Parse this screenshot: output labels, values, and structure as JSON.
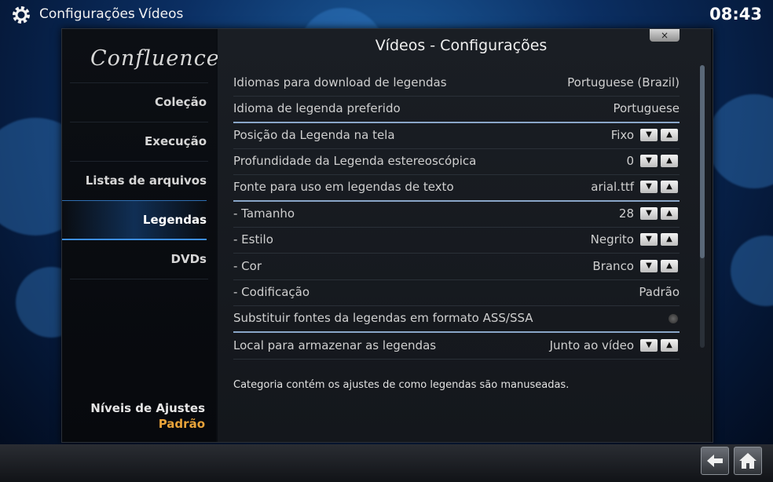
{
  "topbar": {
    "title": "Configurações",
    "subtitle": "- Vídeos",
    "clock": "08:43"
  },
  "sidebar": {
    "logo": "Confluence",
    "items": [
      {
        "label": "Coleção",
        "selected": false
      },
      {
        "label": "Execução",
        "selected": false
      },
      {
        "label": "Listas de arquivos",
        "selected": false
      },
      {
        "label": "Legendas",
        "selected": true
      },
      {
        "label": "DVDs",
        "selected": false
      }
    ],
    "levels_label": "Níveis de Ajustes",
    "levels_value": "Padrão"
  },
  "dialog": {
    "heading": "Vídeos - Configurações",
    "close_label": "×",
    "description": "Categoria contém os ajustes de como legendas são manuseadas."
  },
  "settings": [
    {
      "label": "Idiomas para download de legendas",
      "value": "Portuguese (Brazil)"
    },
    {
      "label": "Idioma de legenda preferido",
      "value": "Portuguese"
    },
    {
      "label": "Posição da Legenda na tela",
      "value": "Fixo"
    },
    {
      "label": "Profundidade da Legenda estereoscópica",
      "value": "0"
    },
    {
      "label": "Fonte para uso em legendas de texto",
      "value": "arial.ttf"
    },
    {
      "label": "- Tamanho",
      "value": "28"
    },
    {
      "label": "- Estilo",
      "value": "Negrito"
    },
    {
      "label": "- Cor",
      "value": "Branco"
    },
    {
      "label": "- Codificação",
      "value": "Padrão"
    },
    {
      "label": "Substituir fontes da legendas em formato ASS/SSA",
      "value": ""
    },
    {
      "label": "Local para armazenar as legendas",
      "value": "Junto ao vídeo"
    }
  ],
  "icons": {
    "gear": "gear-icon",
    "back": "back-arrow-icon",
    "home": "home-icon",
    "spin_down": "triangle-down-icon",
    "spin_up": "triangle-up-icon"
  },
  "colors": {
    "accent": "#3d8ee0",
    "level_value": "#e8a33a"
  }
}
